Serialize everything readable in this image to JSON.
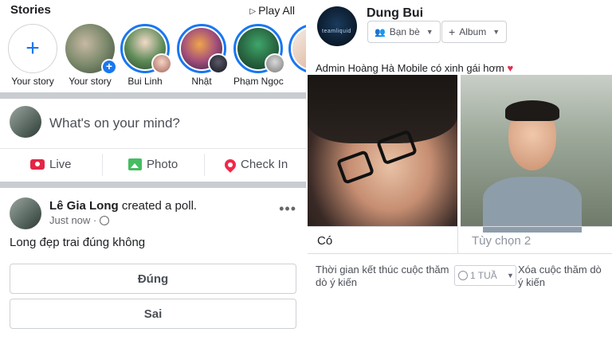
{
  "stories": {
    "title": "Stories",
    "play_all": "Play All",
    "items": [
      {
        "label": "Your story"
      },
      {
        "label": "Your story"
      },
      {
        "label": "Bui Linh"
      },
      {
        "label": "Nhật"
      },
      {
        "label": "Phạm Ngọc"
      }
    ]
  },
  "composer": {
    "placeholder": "What's on your mind?",
    "actions": [
      {
        "label": "Live",
        "icon": "video-camera-icon",
        "color": "#e42645"
      },
      {
        "label": "Photo",
        "icon": "photo-icon",
        "color": "#45bd62"
      },
      {
        "label": "Check In",
        "icon": "location-pin-icon",
        "color": "#f02849"
      }
    ]
  },
  "post": {
    "author": "Lê Gia Long",
    "action_text": "created a poll.",
    "time": "Just now ·",
    "text": "Long đẹp trai đúng không",
    "options": [
      "Đúng",
      "Sai"
    ]
  },
  "right_post": {
    "author": "Dung Bui",
    "logo_text": "teamliquid",
    "audience_label": "Bạn bè",
    "album_label": "Album",
    "caption": "Admin Hoàng Hà Mobile có xinh gái hơm",
    "options": [
      "Có",
      "Tùy chọn 2"
    ],
    "end_time_label": "Thời gian kết thúc cuộc thăm dò ý kiến",
    "duration": "1 TUẦ",
    "delete_label": "Xóa cuộc thăm dò ý kiến"
  },
  "colors": {
    "accent": "#1877f2",
    "divider": "#c9ccd1"
  }
}
